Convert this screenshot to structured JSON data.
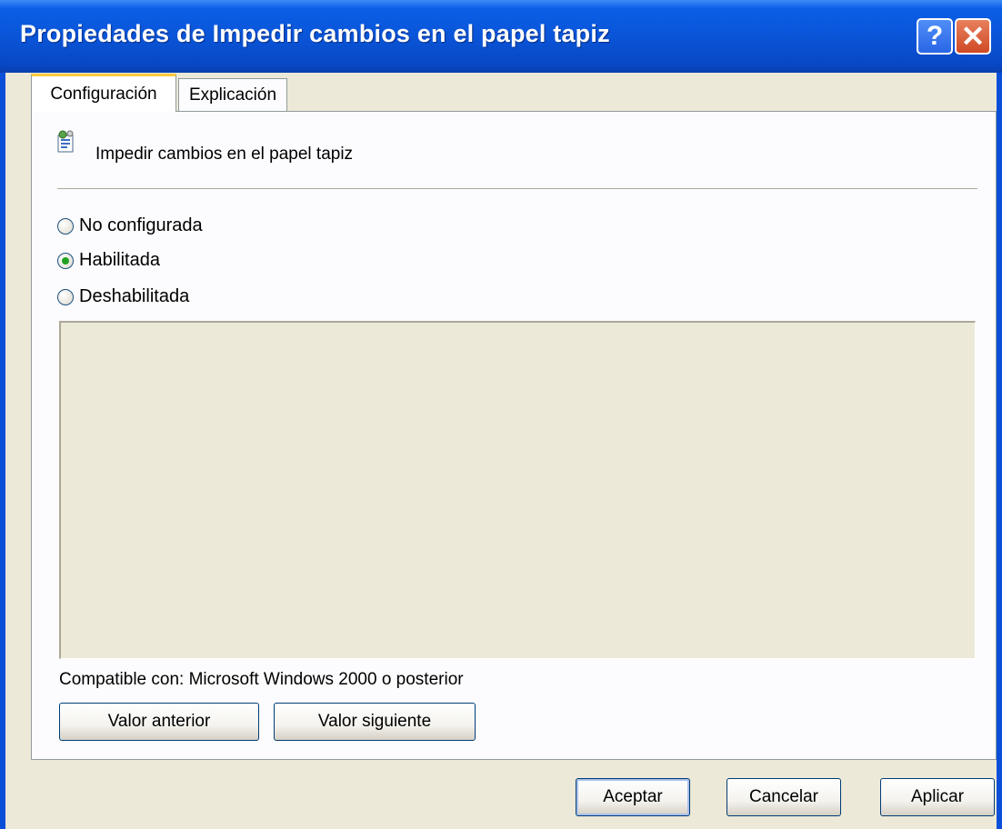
{
  "window": {
    "title": "Propiedades de Impedir cambios en el papel tapiz"
  },
  "titlebar_buttons": {
    "help": "?",
    "close": "✕"
  },
  "tabs": [
    {
      "label": "Configuración",
      "active": true
    },
    {
      "label": "Explicación",
      "active": false
    }
  ],
  "policy": {
    "icon": "policy-settings-icon",
    "name": "Impedir cambios en el papel tapiz"
  },
  "options": [
    {
      "label": "No configurada",
      "checked": false
    },
    {
      "label": "Habilitada",
      "checked": true
    },
    {
      "label": "Deshabilitada",
      "checked": false
    }
  ],
  "compatibility": "Compatible con: Microsoft Windows 2000 o posterior",
  "nav_buttons": {
    "previous": "Valor anterior",
    "next": "Valor siguiente"
  },
  "dialog_buttons": {
    "ok": "Aceptar",
    "cancel": "Cancelar",
    "apply": "Aplicar"
  },
  "colors": {
    "titlebar": "#0a55d8",
    "window_bg": "#ece9d8",
    "tab_accent": "#ffc83c",
    "close_button": "#cf4a24",
    "radio_selected": "#21a121"
  }
}
